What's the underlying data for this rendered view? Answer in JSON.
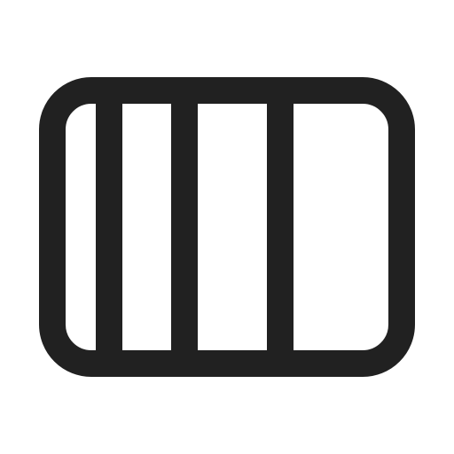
{
  "icon": {
    "name": "column-layout-icon",
    "stroke_color": "#212121",
    "background_color": "#ffffff"
  }
}
